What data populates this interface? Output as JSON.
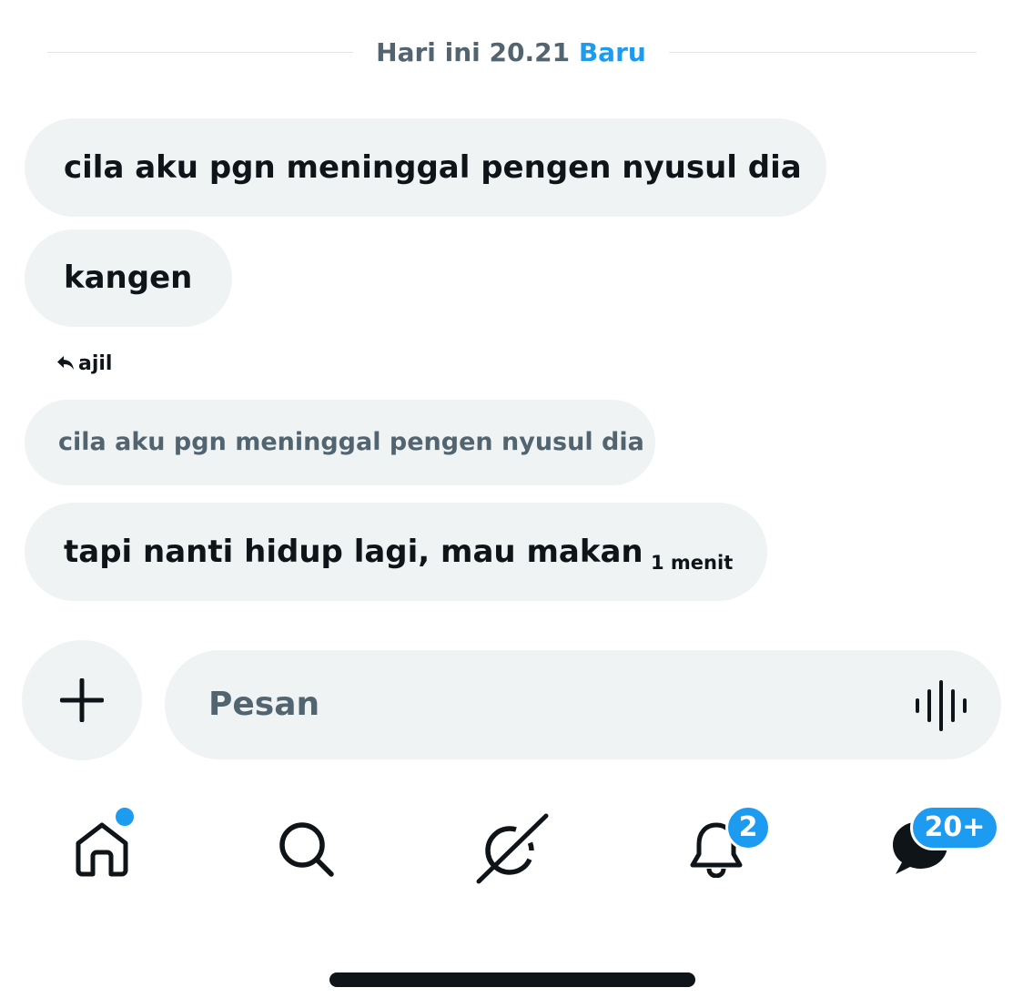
{
  "divider": {
    "date_label": "Hari ini 20.21",
    "new_label": "Baru"
  },
  "messages": [
    {
      "text": "cila aku pgn meninggal pengen nyusul dia"
    },
    {
      "text": "kangen"
    },
    {
      "text": "tapi nanti hidup lagi, mau makan",
      "time": "1 menit"
    }
  ],
  "reply": {
    "author": "ajil",
    "quoted_text": "cila aku pgn meninggal pengen nyusul dia"
  },
  "composer": {
    "placeholder": "Pesan",
    "add_icon": "plus-icon",
    "voice_icon": "voice-waveform-icon"
  },
  "nav": {
    "items": [
      {
        "icon": "home-icon",
        "has_dot": true
      },
      {
        "icon": "search-icon"
      },
      {
        "icon": "grok-icon"
      },
      {
        "icon": "bell-icon",
        "badge": "2"
      },
      {
        "icon": "messages-icon",
        "badge": "20+"
      }
    ]
  },
  "colors": {
    "accent": "#1d9bf0",
    "bubble": "#eff3f4",
    "text": "#0f1419",
    "muted": "#536471"
  }
}
